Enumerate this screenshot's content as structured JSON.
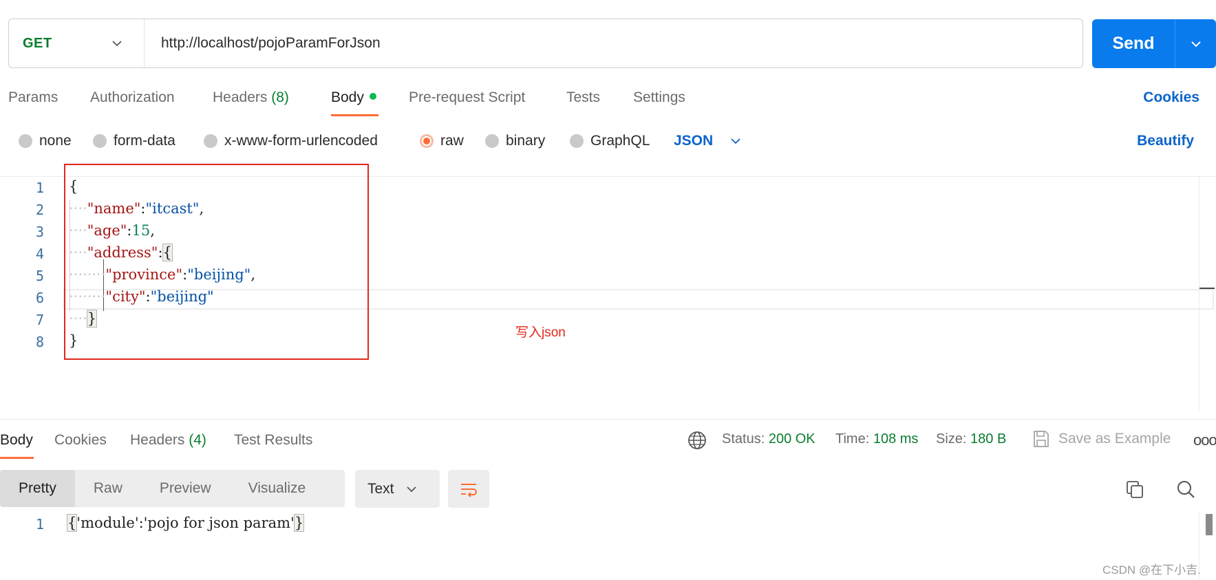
{
  "request": {
    "method": "GET",
    "url": "http://localhost/pojoParamForJson",
    "send_label": "Send"
  },
  "tabs": [
    {
      "label": "Params"
    },
    {
      "label": "Authorization"
    },
    {
      "label": "Headers",
      "count": "(8)"
    },
    {
      "label": "Body"
    },
    {
      "label": "Pre-request Script"
    },
    {
      "label": "Tests"
    },
    {
      "label": "Settings"
    }
  ],
  "active_tab": "Body",
  "cookies_label": "Cookies",
  "body_types": [
    {
      "label": "none",
      "selected": false
    },
    {
      "label": "form-data",
      "selected": false
    },
    {
      "label": "x-www-form-urlencoded",
      "selected": false
    },
    {
      "label": "raw",
      "selected": true
    },
    {
      "label": "binary",
      "selected": false
    },
    {
      "label": "GraphQL",
      "selected": false
    }
  ],
  "raw_format": "JSON",
  "beautify_label": "Beautify",
  "editor": {
    "line_numbers": [
      "1",
      "2",
      "3",
      "4",
      "5",
      "6",
      "7",
      "8"
    ],
    "lines": [
      {
        "open": "{"
      },
      {
        "ws": "····",
        "key": "\"name\"",
        "colon": ":",
        "str": "\"itcast\"",
        "tail": ","
      },
      {
        "ws": "····",
        "key": "\"age\"",
        "colon": ":",
        "num": "15",
        "tail": ","
      },
      {
        "ws": "····",
        "key": "\"address\"",
        "colon": ":",
        "brace": "{"
      },
      {
        "ws": "········",
        "key": "\"province\"",
        "colon": ":",
        "str": "\"beijing\"",
        "tail": ","
      },
      {
        "ws": "········",
        "key": "\"city\"",
        "colon": ":",
        "str": "\"beijing\""
      },
      {
        "ws": "····",
        "brace": "}"
      },
      {
        "close": "}"
      }
    ]
  },
  "annotation": "写入json",
  "response": {
    "tabs": [
      {
        "label": "Body"
      },
      {
        "label": "Cookies"
      },
      {
        "label": "Headers",
        "count": "(4)"
      },
      {
        "label": "Test Results"
      }
    ],
    "status_label": "Status:",
    "status_value": "200 OK",
    "time_label": "Time:",
    "time_value": "108 ms",
    "size_label": "Size:",
    "size_value": "180 B",
    "save_example": "Save as Example",
    "more": "ooo",
    "view_modes": [
      "Pretty",
      "Raw",
      "Preview",
      "Visualize"
    ],
    "format": "Text",
    "body_line_number": "1",
    "body_open": "{",
    "body_text": "'module':'pojo for json param'",
    "body_close": "}"
  },
  "watermark": "CSDN @在下小吉.",
  "colors": {
    "accent": "#ff6c37",
    "send": "#097bed",
    "link": "#0b64c9",
    "ok_green": "#0a7d2f",
    "annotation_red": "#e0261b"
  },
  "icons": [
    "chevron-down-icon",
    "globe-icon",
    "save-icon",
    "wrap-icon",
    "copy-icon",
    "search-icon"
  ]
}
